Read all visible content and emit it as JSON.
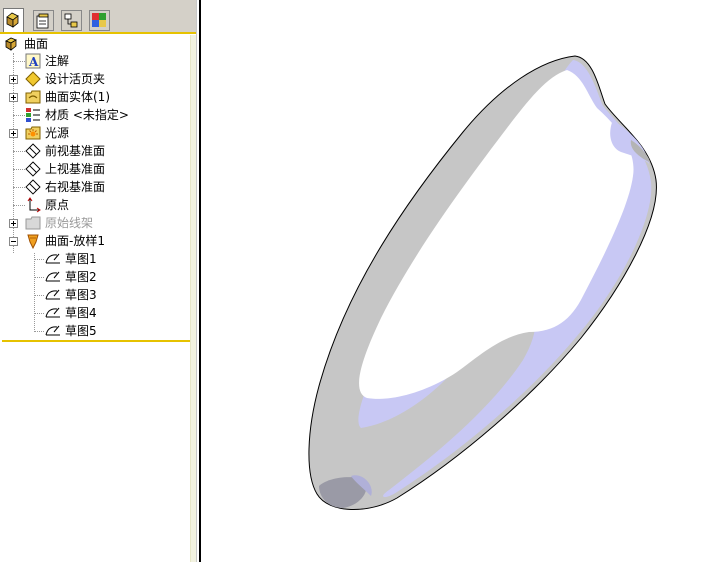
{
  "tabs": [
    {
      "name": "featuremanager-tab-icon"
    },
    {
      "name": "propertymanager-tab-icon"
    },
    {
      "name": "configurationmanager-tab-icon"
    },
    {
      "name": "display-manager-tab-icon"
    }
  ],
  "tree": {
    "root": "曲面",
    "items": {
      "annotations": "注解",
      "design_binder": "设计活页夹",
      "surface_bodies": "曲面实体(1)",
      "material": "材质 <未指定>",
      "lights": "光源",
      "front_plane": "前视基准面",
      "top_plane": "上视基准面",
      "right_plane": "右视基准面",
      "origin": "原点",
      "original_wireframe": "原始线架",
      "surface_loft": "曲面-放样1"
    },
    "sketches": [
      "草图1",
      "草图2",
      "草图3",
      "草图4",
      "草图5"
    ]
  },
  "colors": {
    "tab_accent": "#e6c200",
    "surface_white": "#ffffff",
    "surface_lavender": "#c8c8f4",
    "surface_grey": "#c6c6c6",
    "surface_darkgrey": "#9a9aa6"
  }
}
